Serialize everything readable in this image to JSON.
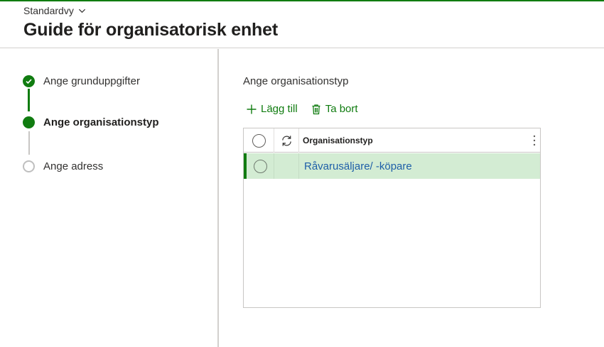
{
  "header": {
    "view_selector": "Standardvy",
    "title": "Guide för organisatorisk enhet"
  },
  "steps": [
    {
      "label": "Ange grunduppgifter",
      "state": "done"
    },
    {
      "label": "Ange organisationstyp",
      "state": "active"
    },
    {
      "label": "Ange adress",
      "state": "todo"
    }
  ],
  "content": {
    "section_title": "Ange organisationstyp",
    "toolbar": {
      "add_label": "Lägg till",
      "delete_label": "Ta bort"
    },
    "grid": {
      "column_header": "Organisationstyp",
      "rows": [
        {
          "value": "Råvarusäljare/ -köpare",
          "selected": true
        }
      ]
    }
  },
  "colors": {
    "accent": "#107c10",
    "row_selected_bg": "#d3ecd3",
    "link": "#1e5fa8"
  },
  "icons": {
    "view_chevron": "chevron-down-icon",
    "step_done": "checkmark-icon",
    "add": "plus-icon",
    "delete": "trash-icon",
    "refresh": "refresh-icon",
    "more": "more-vertical-icon"
  }
}
